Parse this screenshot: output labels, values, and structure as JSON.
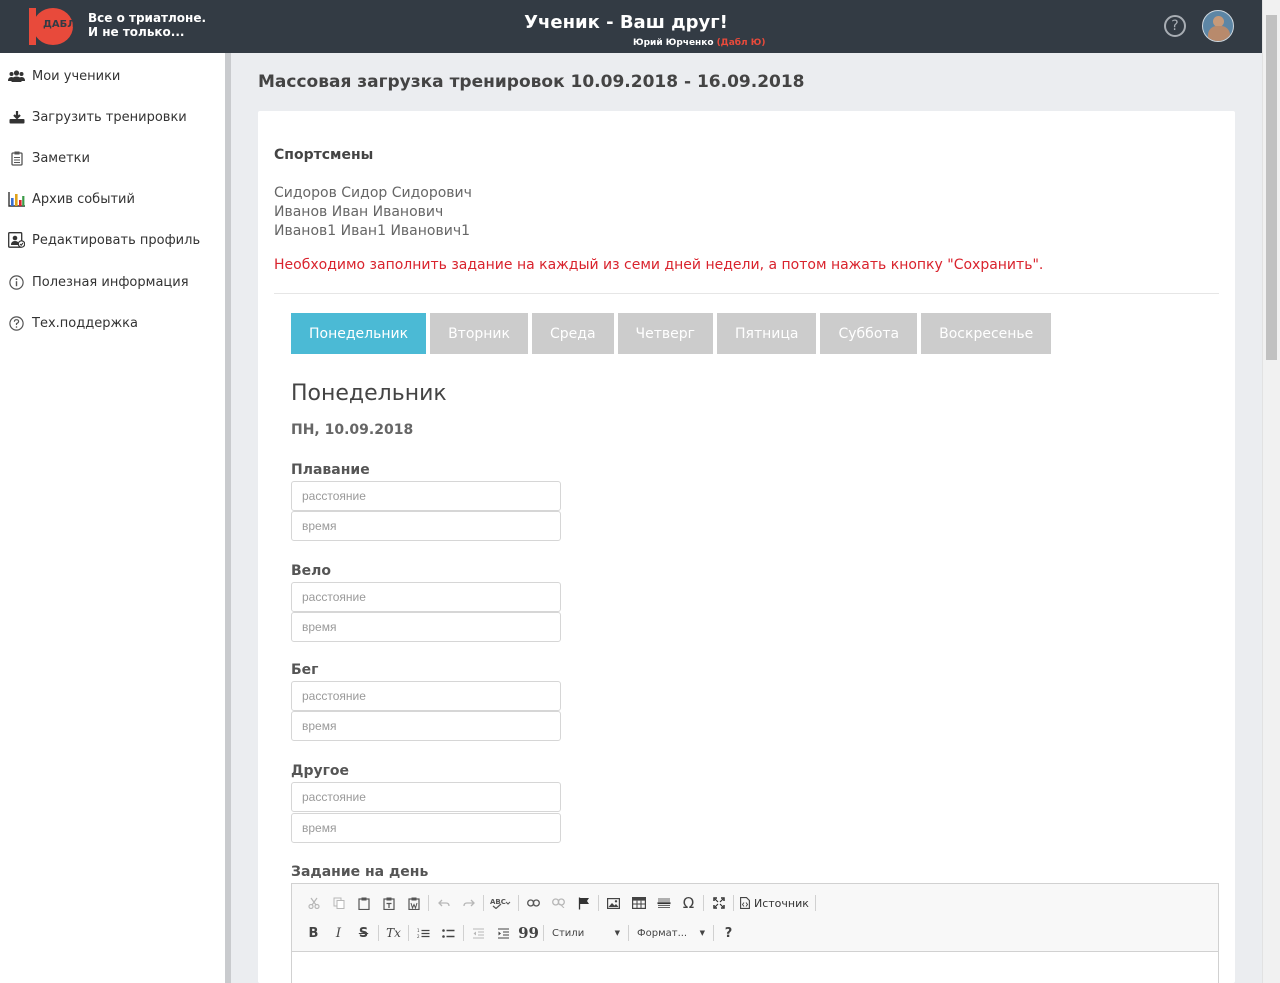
{
  "header": {
    "logo_text": "ДАБЛ",
    "tagline_line1": "Все о триатлоне.",
    "tagline_line2": "И не только...",
    "app_title": "Ученик - Ваш друг!",
    "user_name": "Юрий Юрченко",
    "user_role": "(Дабл Ю)",
    "help_glyph": "?"
  },
  "sidebar": {
    "items": [
      {
        "label": "Мои ученики",
        "icon": "users-icon"
      },
      {
        "label": "Загрузить тренировки",
        "icon": "upload-icon"
      },
      {
        "label": "Заметки",
        "icon": "notes-icon"
      },
      {
        "label": "Архив событий",
        "icon": "chart-icon"
      },
      {
        "label": "Редактировать профиль",
        "icon": "profile-edit-icon"
      },
      {
        "label": "Полезная информация",
        "icon": "info-icon"
      },
      {
        "label": "Тех.поддержка",
        "icon": "support-icon"
      }
    ]
  },
  "main": {
    "page_title": "Массовая загрузка тренировок 10.09.2018 - 16.09.2018",
    "athletes_title": "Спортсмены",
    "athletes": [
      "Сидоров Сидор Сидорович",
      "Иванов Иван Иванович",
      "Иванов1 Иван1 Иванович1"
    ],
    "warning": "Необходимо заполнить задание на каждый из семи дней недели, а потом нажать кнопку \"Сохранить\".",
    "tabs": [
      "Понедельник",
      "Вторник",
      "Среда",
      "Четверг",
      "Пятница",
      "Суббота",
      "Воскресенье"
    ],
    "active_tab": "Понедельник",
    "day_title": "Понедельник",
    "day_date": "ПН, 10.09.2018",
    "sports": [
      {
        "label": "Плавание",
        "distance_placeholder": "расстояние",
        "time_placeholder": "время"
      },
      {
        "label": "Вело",
        "distance_placeholder": "расстояние",
        "time_placeholder": "время"
      },
      {
        "label": "Бег",
        "distance_placeholder": "расстояние",
        "time_placeholder": "время"
      },
      {
        "label": "Другое",
        "distance_placeholder": "расстояние",
        "time_placeholder": "время"
      }
    ],
    "task_label": "Задание на день",
    "editor": {
      "source_label": "Источник",
      "styles_label": "Стили",
      "format_label": "Формат...",
      "bold": "B",
      "italic": "I",
      "strike": "S",
      "remove_format": "Tx",
      "help": "?",
      "quote": "99",
      "special_char": "Ω"
    }
  },
  "colors": {
    "header_bg": "#333b44",
    "brand_red": "#e84a3b",
    "active_tab": "#4bbad5",
    "inactive_tab": "#cccccc",
    "warning": "#d9232d"
  }
}
